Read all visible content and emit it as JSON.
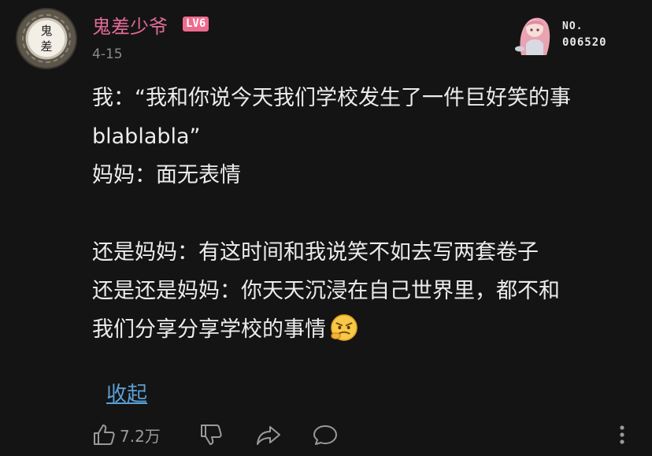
{
  "user": {
    "name": "鬼差少爷",
    "level": "LV6",
    "avatar_text": [
      "鬼",
      "差"
    ],
    "date": "4-15"
  },
  "fan_badge": {
    "label": "NO.",
    "number": "006520",
    "icon": "anime-girl-figure"
  },
  "comment": {
    "lines": [
      "我：“我和你说今天我们学校发生了一件巨好笑的事",
      "blablabla”",
      "妈妈：面无表情",
      "",
      "还是妈妈：有这时间和我说笑不如去写两套卷子",
      "还是还是妈妈：你天天沉浸在自己世界里，都不和",
      "我们分享分享学校的事情"
    ],
    "trailing_emoji": "angry-emoji"
  },
  "collapse_label": "收起",
  "actions": {
    "like_count": "7.2万",
    "icons": [
      "thumbs-up-icon",
      "thumbs-down-icon",
      "share-icon",
      "reply-icon",
      "more-icon"
    ]
  },
  "colors": {
    "background": "#141414",
    "username": "#e26b98",
    "level_badge": "#ee6b8d",
    "link": "#5b9fd6",
    "muted": "#8a8a8a"
  }
}
